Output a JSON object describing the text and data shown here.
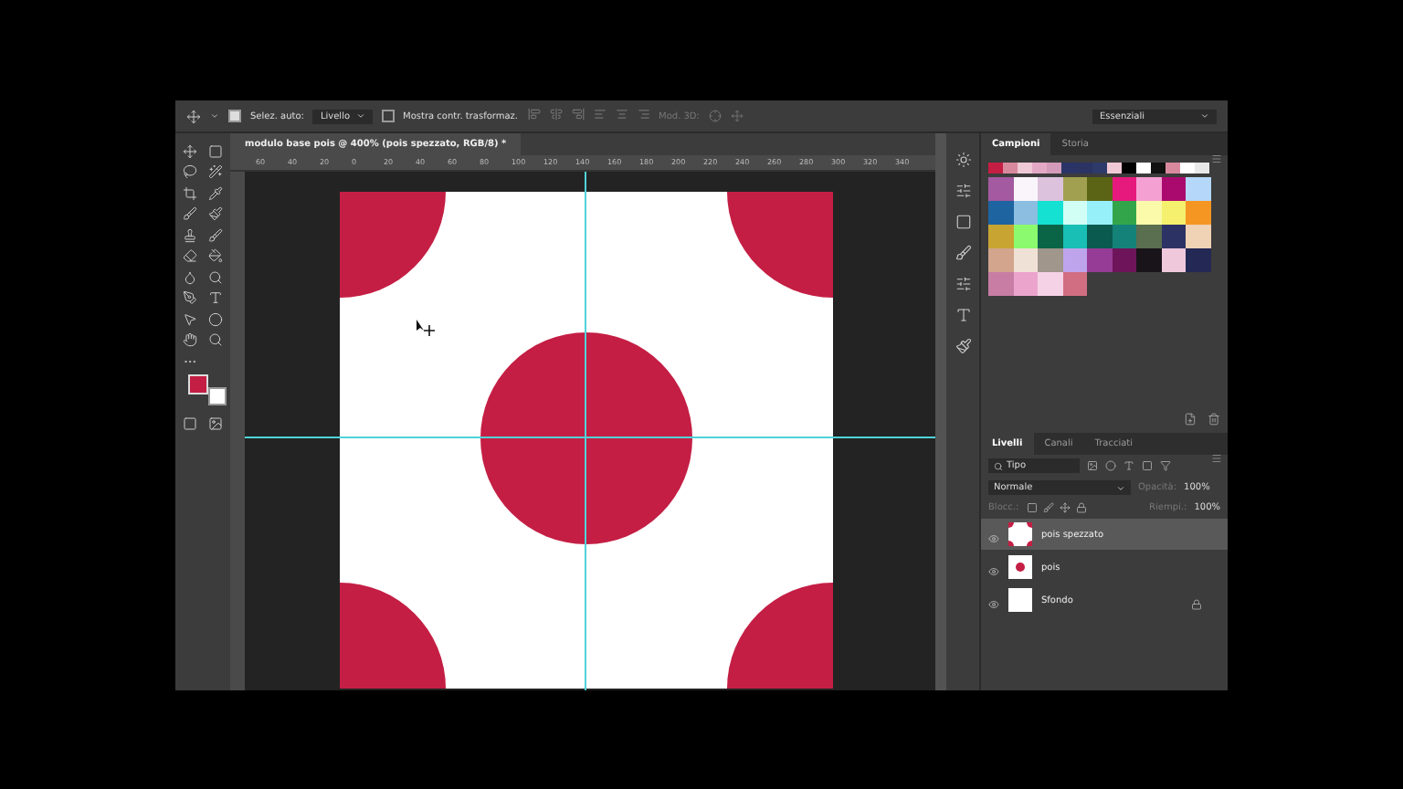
{
  "options_bar": {
    "auto_select": {
      "label": "Selez. auto:",
      "checked": true
    },
    "auto_select_target": "Livello",
    "transform_controls": {
      "label": "Mostra contr. trasformaz.",
      "checked": false
    },
    "mode_3d": "Mod. 3D:",
    "workspace": "Essenziali"
  },
  "document_tab": {
    "title": "modulo base pois @ 400% (pois spezzato, RGB/8) *"
  },
  "ruler": {
    "labels": [
      "60",
      "40",
      "20",
      "0",
      "20",
      "40",
      "60",
      "80",
      "100",
      "120",
      "140",
      "160",
      "180",
      "200",
      "220",
      "240",
      "260",
      "280",
      "300",
      "320",
      "340"
    ]
  },
  "colors": {
    "foreground": {
      "color": "#c41e44"
    },
    "background": {
      "color": "#ffffff"
    }
  },
  "swatches_panel": {
    "tabs": [
      {
        "label": "Campioni",
        "selected": true
      },
      {
        "label": "Storia",
        "selected": false
      }
    ],
    "recent": [
      {
        "color": "#c41e44"
      },
      {
        "color": "#d9899e"
      },
      {
        "color": "#f0c9d6"
      },
      {
        "color": "#e3a9c4"
      },
      {
        "color": "#d49ab9"
      },
      {
        "color": "#2a3466"
      },
      {
        "color": "#2b3462"
      },
      {
        "color": "#2e3a6a"
      },
      {
        "color": "#f0c9d6"
      },
      {
        "color": "#000000"
      },
      {
        "color": "#ffffff"
      },
      {
        "color": "#111111"
      },
      {
        "color": "#d9899e"
      },
      {
        "color": "#ffffff"
      },
      {
        "color": "#e8e8e8"
      }
    ],
    "swatches": [
      {
        "color": "#a45aa0"
      },
      {
        "color": "#faf5fa"
      },
      {
        "color": "#dcc2dc"
      },
      {
        "color": "#a0a050"
      },
      {
        "color": "#5a6414"
      },
      {
        "color": "#e6197d"
      },
      {
        "color": "#f5a0d2"
      },
      {
        "color": "#aa0a6e"
      },
      {
        "color": "#b4d7fa"
      },
      {
        "color": "#1e64a0"
      },
      {
        "color": "#8cbee1"
      },
      {
        "color": "#14e1d2"
      },
      {
        "color": "#d2fff5"
      },
      {
        "color": "#96f0fa"
      },
      {
        "color": "#32a54b"
      },
      {
        "color": "#fafaaa"
      },
      {
        "color": "#f5f06e"
      },
      {
        "color": "#f59623"
      },
      {
        "color": "#c8a532"
      },
      {
        "color": "#8cfa6e"
      },
      {
        "color": "#0a6446"
      },
      {
        "color": "#19beb4"
      },
      {
        "color": "#0a5a50"
      },
      {
        "color": "#148278"
      },
      {
        "color": "#5a6e50"
      },
      {
        "color": "#2d3264"
      },
      {
        "color": "#f0d2b4"
      },
      {
        "color": "#d2a58c"
      },
      {
        "color": "#f0e1d7"
      },
      {
        "color": "#a0968c"
      },
      {
        "color": "#bea5eb"
      },
      {
        "color": "#963c96"
      },
      {
        "color": "#6e145a"
      },
      {
        "color": "#191419"
      },
      {
        "color": "#f0c8dc"
      },
      {
        "color": "#232855"
      },
      {
        "color": "#c87da5"
      },
      {
        "color": "#eba5cd"
      },
      {
        "color": "#f5d2e6"
      },
      {
        "color": "#d26e82"
      }
    ]
  },
  "layers_panel": {
    "tabs": [
      {
        "label": "Livelli",
        "selected": true
      },
      {
        "label": "Canali",
        "selected": false
      },
      {
        "label": "Tracciati",
        "selected": false
      }
    ],
    "filter": "Tipo",
    "blend_mode": "Normale",
    "opacity_label": "Opacità:",
    "opacity": "100%",
    "lock_label": "Blocc.:",
    "fill_label": "Riempi.:",
    "fill": "100%",
    "layers": [
      {
        "name": "pois spezzato",
        "selected": true,
        "visible": true,
        "kind": "corners",
        "locked": false
      },
      {
        "name": "pois",
        "selected": false,
        "visible": true,
        "kind": "dot",
        "locked": false
      },
      {
        "name": "Sfondo",
        "selected": false,
        "visible": true,
        "kind": "plain",
        "locked": true
      }
    ]
  }
}
